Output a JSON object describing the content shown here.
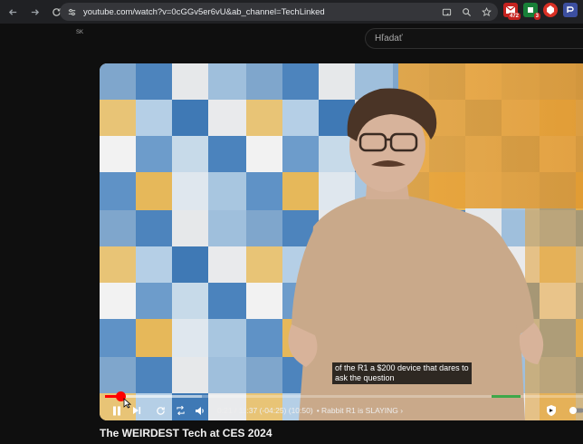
{
  "browser": {
    "url": "youtube.com/watch?v=0cGGv5er6vU&ab_channel=TechLinked",
    "extensions": [
      {
        "name": "gmail-extension",
        "badge": "472",
        "color": "#c5221f"
      },
      {
        "name": "green-extension",
        "badge": "3",
        "color": "#188038"
      },
      {
        "name": "red-extension",
        "badge": "",
        "color": "#d93025"
      },
      {
        "name": "blue-extension",
        "badge": "",
        "color": "#3c4fa0"
      }
    ]
  },
  "youtube": {
    "region_code": "SK",
    "search_placeholder": "Hľadať"
  },
  "player": {
    "caption_lines": [
      "of the R1 a $200 device that dares to",
      "ask the question"
    ],
    "progress_played": 0.031,
    "progress_loaded": 0.2,
    "time_text": "0:21 / 11:37 (-04:25) (10:50)",
    "chapter_text": "• Rabbit R1 is SLAYING",
    "chapter_chevron": "›",
    "colors": {
      "played": "#ff0000",
      "chapter_mark": "#3ea84a"
    }
  },
  "video": {
    "title": "The WEIRDEST Tech at CES 2024"
  }
}
